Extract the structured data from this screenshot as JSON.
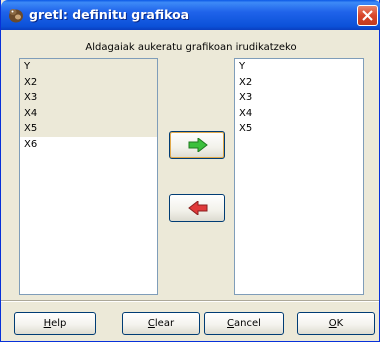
{
  "window": {
    "title": "gretl: definitu grafikoa",
    "app_icon": "gretl-icon",
    "close_icon": "close-icon"
  },
  "prompt": "Aldagaiak aukeratu grafikoan irudikatzeko",
  "left_list": {
    "items": [
      "Y",
      "X2",
      "X3",
      "X4",
      "X5",
      "X6"
    ],
    "selected": [
      "Y",
      "X2",
      "X3",
      "X4",
      "X5"
    ]
  },
  "right_list": {
    "items": [
      "Y",
      "X2",
      "X3",
      "X4",
      "X5"
    ]
  },
  "arrows": {
    "add_icon": "arrow-right-icon",
    "add_color": "#3cc03c",
    "remove_icon": "arrow-left-icon",
    "remove_color": "#e03a3a"
  },
  "buttons": {
    "help": {
      "mnemonic": "H",
      "rest": "elp"
    },
    "clear": {
      "mnemonic": "C",
      "rest": "lear"
    },
    "cancel": {
      "mnemonic": "C",
      "rest": "ancel"
    },
    "ok": {
      "mnemonic": "O",
      "rest": "K"
    }
  }
}
